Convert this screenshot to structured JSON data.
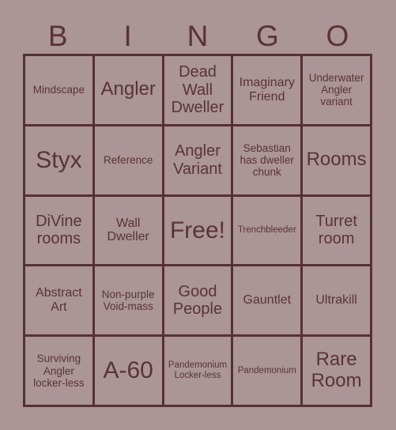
{
  "card": {
    "title": "BINGO",
    "background_color": "#ab9596",
    "border_color": "#553135",
    "text_color": "#5a3336"
  },
  "header": {
    "letters": [
      "B",
      "I",
      "N",
      "G",
      "O"
    ]
  },
  "grid": {
    "rows": 5,
    "columns": 5,
    "cells": [
      {
        "text": "Mindscape",
        "size": "sm",
        "free": false
      },
      {
        "text": "Angler",
        "size": "xl",
        "free": false
      },
      {
        "text": "Dead Wall Dweller",
        "size": "lg",
        "free": false
      },
      {
        "text": "Imaginary Friend",
        "size": "md",
        "free": false
      },
      {
        "text": "Underwater Angler variant",
        "size": "sm",
        "free": false
      },
      {
        "text": "Styx",
        "size": "xxl",
        "free": false
      },
      {
        "text": "Reference",
        "size": "sm",
        "free": false
      },
      {
        "text": "Angler Variant",
        "size": "lg",
        "free": false
      },
      {
        "text": "Sebastian has dweller chunk",
        "size": "sm",
        "free": false
      },
      {
        "text": "Rooms",
        "size": "xl",
        "free": false
      },
      {
        "text": "DiVine rooms",
        "size": "lg",
        "free": false
      },
      {
        "text": "Wall Dweller",
        "size": "md",
        "free": false
      },
      {
        "text": "Free!",
        "size": "xxl",
        "free": true
      },
      {
        "text": "Trenchbleeder",
        "size": "xs",
        "free": false
      },
      {
        "text": "Turret room",
        "size": "lg",
        "free": false
      },
      {
        "text": "Abstract Art",
        "size": "md",
        "free": false
      },
      {
        "text": "Non-purple Void-mass",
        "size": "sm",
        "free": false
      },
      {
        "text": "Good People",
        "size": "lg",
        "free": false
      },
      {
        "text": "Gauntlet",
        "size": "md",
        "free": false
      },
      {
        "text": "Ultrakill",
        "size": "md",
        "free": false
      },
      {
        "text": "Surviving Angler locker-less",
        "size": "sm",
        "free": false
      },
      {
        "text": "A-60",
        "size": "xxl",
        "free": false
      },
      {
        "text": "Pandemonium Locker-less",
        "size": "xs",
        "free": false
      },
      {
        "text": "Pandemonium",
        "size": "xs",
        "free": false
      },
      {
        "text": "Rare Room",
        "size": "xl",
        "free": false
      }
    ]
  }
}
